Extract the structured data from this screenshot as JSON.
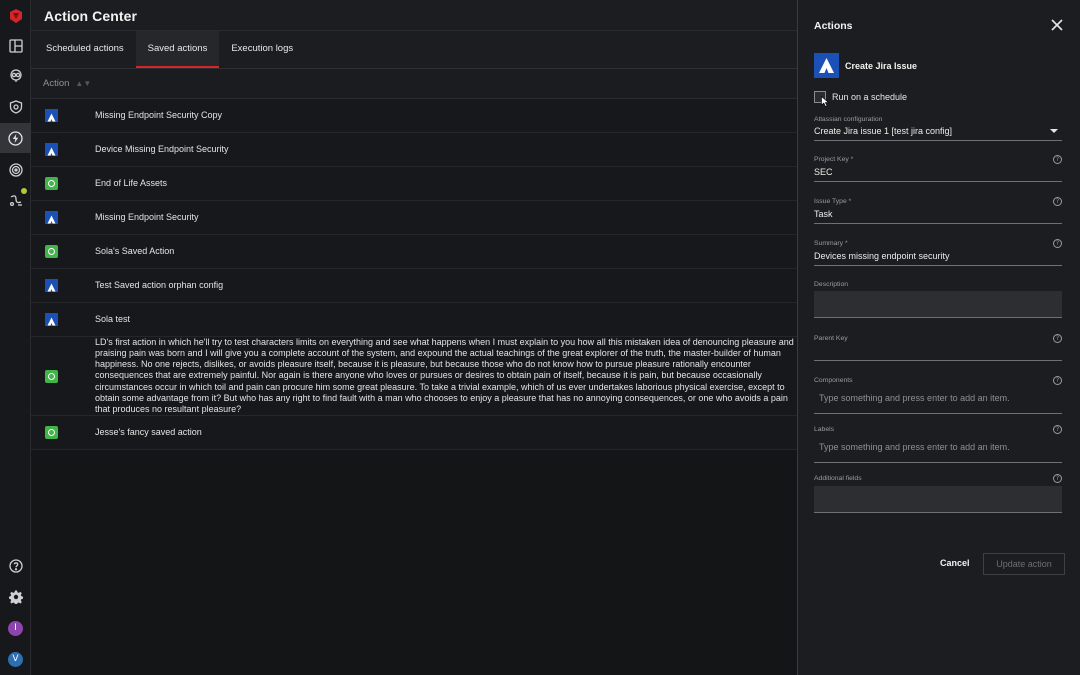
{
  "sidebar": {
    "items": [
      {
        "icon": "logo-icon"
      },
      {
        "icon": "dashboard-icon"
      },
      {
        "icon": "brain-icon"
      },
      {
        "icon": "shield-icon"
      },
      {
        "icon": "lightning-icon",
        "active": true
      },
      {
        "icon": "radar-icon"
      },
      {
        "icon": "connector-icon"
      }
    ],
    "bottom": [
      {
        "icon": "help-icon"
      },
      {
        "icon": "gear-icon"
      }
    ],
    "avatars": [
      {
        "letter": "I",
        "color": "#8e44ad"
      },
      {
        "letter": "V",
        "color": "#2e6fb2"
      }
    ]
  },
  "header": {
    "title": "Action Center"
  },
  "tabs": [
    {
      "label": "Scheduled actions"
    },
    {
      "label": "Saved actions",
      "active": true
    },
    {
      "label": "Execution logs"
    }
  ],
  "table": {
    "column": "Action",
    "rows": [
      {
        "type": "atlassian",
        "name": "Missing Endpoint Security Copy"
      },
      {
        "type": "atlassian",
        "name": "Device Missing Endpoint Security"
      },
      {
        "type": "green",
        "name": "End of Life Assets"
      },
      {
        "type": "atlassian",
        "name": "Missing Endpoint Security"
      },
      {
        "type": "green",
        "name": "Sola's Saved Action"
      },
      {
        "type": "atlassian",
        "name": "Test Saved action orphan config"
      },
      {
        "type": "atlassian",
        "name": "Sola test"
      },
      {
        "type": "green",
        "name": "LD's first action in which he'll try to test characters limits on everything and see what happens when I must explain to you how all this mistaken idea of denouncing pleasure and praising pain was born and I will give you a complete account of the system, and expound the actual teachings of the great explorer of the truth, the master-builder of human happiness. No one rejects, dislikes, or avoids pleasure itself, because it is pleasure, but because those who do not know how to pursue pleasure rationally encounter consequences that are extremely painful. Nor again is there anyone who loves or pursues or desires to obtain pain of itself, because it is pain, but because occasionally circumstances occur in which toil and pain can procure him some great pleasure. To take a trivial example, which of us ever undertakes laborious physical exercise, except to obtain some advantage from it? But who has any right to find fault with a man who chooses to enjoy a pleasure that has no annoying consequences, or one who avoids a pain that produces no resultant pleasure?",
        "tall": true
      },
      {
        "type": "green",
        "name": "Jesse's fancy saved action"
      }
    ]
  },
  "panel": {
    "title": "Actions",
    "integration": "Create Jira Issue",
    "schedule_label": "Run on a schedule",
    "config": {
      "label": "Atlassian configuration",
      "value": "Create Jira issue 1 [test jira config]"
    },
    "project_key": {
      "label": "Project Key *",
      "value": "SEC"
    },
    "issue_type": {
      "label": "Issue Type *",
      "value": "Task"
    },
    "summary": {
      "label": "Summary *",
      "value": "Devices missing endpoint security"
    },
    "description": {
      "label": "Description",
      "value": ""
    },
    "parent_key": {
      "label": "Parent Key",
      "value": ""
    },
    "components": {
      "label": "Components",
      "placeholder": "Type something and press enter to add an item."
    },
    "labels": {
      "label": "Labels",
      "placeholder": "Type something and press enter to add an item."
    },
    "additional": {
      "label": "Additional fields",
      "value": ""
    },
    "cancel": "Cancel",
    "update": "Update action"
  }
}
